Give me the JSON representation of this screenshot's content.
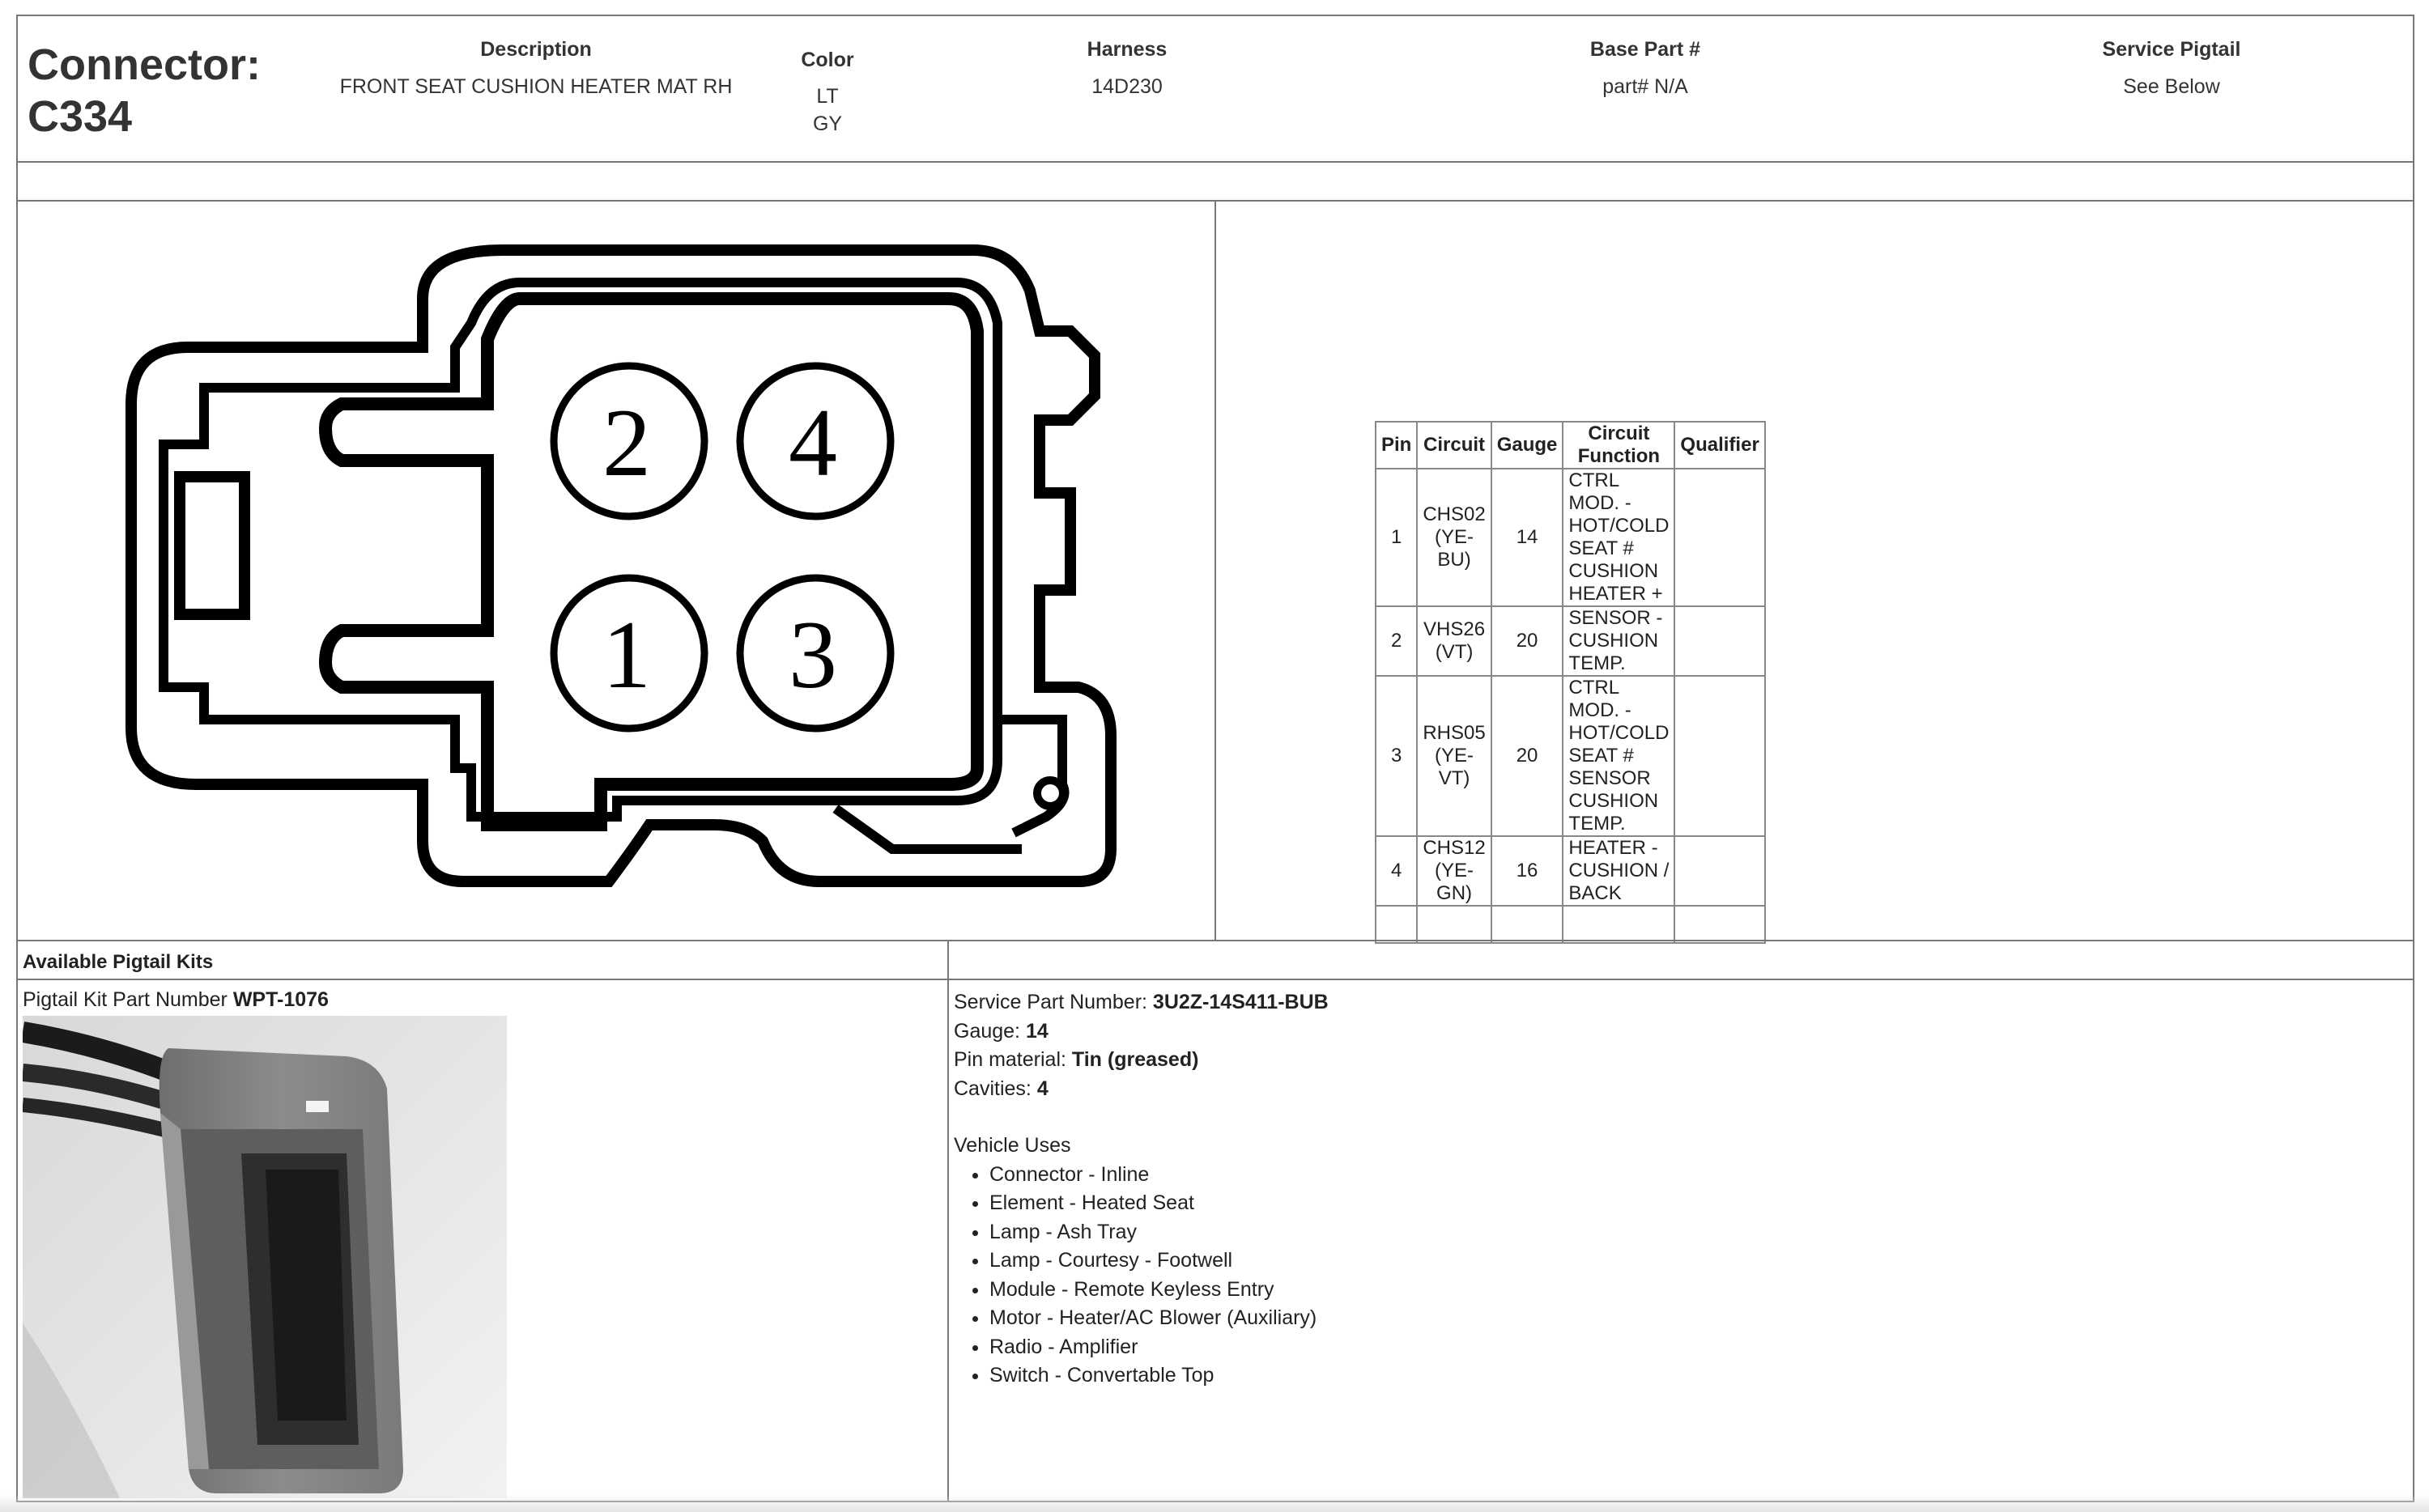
{
  "connector": {
    "title_line1": "Connector:",
    "title_line2": "C334"
  },
  "header": {
    "description": {
      "label": "Description",
      "value": "FRONT SEAT CUSHION HEATER MAT RH"
    },
    "color": {
      "label": "Color",
      "value1": "LT",
      "value2": "GY"
    },
    "harness": {
      "label": "Harness",
      "value": "14D230"
    },
    "base_part": {
      "label": "Base Part #",
      "value": "part# N/A"
    },
    "service_pigtail": {
      "label": "Service Pigtail",
      "value": "See Below"
    }
  },
  "diagram": {
    "pins": [
      "2",
      "4",
      "1",
      "3"
    ]
  },
  "pin_table": {
    "headers": [
      "Pin",
      "Circuit",
      "Gauge",
      "Circuit Function",
      "Qualifier"
    ],
    "rows": [
      {
        "pin": "1",
        "circuit": "CHS02 (YE-BU)",
        "gauge": "14",
        "function": "CTRL MOD. - HOT/COLD SEAT # CUSHION HEATER +",
        "qualifier": ""
      },
      {
        "pin": "2",
        "circuit": "VHS26 (VT)",
        "gauge": "20",
        "function": "SENSOR - CUSHION TEMP.",
        "qualifier": ""
      },
      {
        "pin": "3",
        "circuit": "RHS05 (YE-VT)",
        "gauge": "20",
        "function": "CTRL MOD. - HOT/COLD SEAT # SENSOR CUSHION TEMP.",
        "qualifier": ""
      },
      {
        "pin": "4",
        "circuit": "CHS12 (YE-GN)",
        "gauge": "16",
        "function": "HEATER - CUSHION / BACK",
        "qualifier": ""
      },
      {
        "pin": "",
        "circuit": "",
        "gauge": "",
        "function": "",
        "qualifier": ""
      }
    ]
  },
  "pigtail": {
    "section_title": "Available Pigtail Kits",
    "kit_label": "Pigtail Kit Part Number",
    "kit_number": "WPT-1076",
    "service_part_label": "Service Part Number:",
    "service_part_value": "3U2Z-14S411-BUB",
    "gauge_label": "Gauge:",
    "gauge_value": "14",
    "pin_material_label": "Pin material:",
    "pin_material_value": "Tin (greased)",
    "cavities_label": "Cavities:",
    "cavities_value": "4",
    "vehicle_uses_title": "Vehicle Uses",
    "vehicle_uses": [
      "Connector - Inline",
      "Element - Heated Seat",
      "Lamp - Ash Tray",
      "Lamp - Courtesy - Footwell",
      "Module - Remote Keyless Entry",
      "Motor - Heater/AC Blower (Auxiliary)",
      "Radio - Amplifier",
      "Switch - Convertable Top"
    ]
  }
}
